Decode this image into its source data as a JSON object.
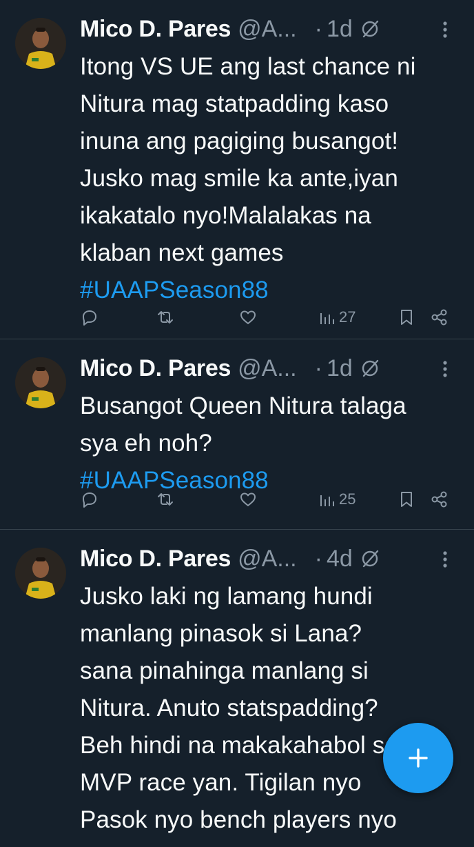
{
  "tweets": [
    {
      "author": "Mico D. Pares",
      "handle": "@A...",
      "separator": "·",
      "time": "1d",
      "lines": [
        "Itong VS UE ang last chance ni",
        "Nitura mag statpadding kaso",
        "inuna ang pagiging busangot!",
        "Jusko mag smile ka ante,iyan",
        "ikakatalo nyo!Malalakas na",
        "klaban next games"
      ],
      "hashtag": "#UAAPSeason88",
      "views": "27"
    },
    {
      "author": "Mico D. Pares",
      "handle": "@A...",
      "separator": "·",
      "time": "1d",
      "lines": [
        "Busangot Queen Nitura talaga",
        "sya eh noh?"
      ],
      "hashtag": "#UAAPSeason88",
      "views": "25"
    },
    {
      "author": "Mico D. Pares",
      "handle": "@A...",
      "separator": "·",
      "time": "4d",
      "lines": [
        "Jusko laki ng lamang hundi",
        "manlang pinasok si Lana?",
        "sana pinahinga manlang si",
        "Nitura. Anuto statspadding?",
        "Beh hindi na makakahabol sa",
        "MVP race yan. Tigilan nyo",
        "Pasok nyo bench players nyo"
      ],
      "hashtag": "",
      "views": ""
    }
  ],
  "icons": {
    "avatar": "profile-photo",
    "grok": "grok-icon",
    "more": "more-vertical-icon",
    "reply": "reply-icon",
    "retweet": "retweet-icon",
    "like": "heart-icon",
    "views": "views-icon",
    "bookmark": "bookmark-icon",
    "share": "share-icon",
    "compose": "plus-icon"
  },
  "colors": {
    "background": "#15202b",
    "text": "#f7f9f9",
    "secondary": "#8b98a5",
    "accent": "#1d9bf0",
    "divider": "#38444d"
  }
}
